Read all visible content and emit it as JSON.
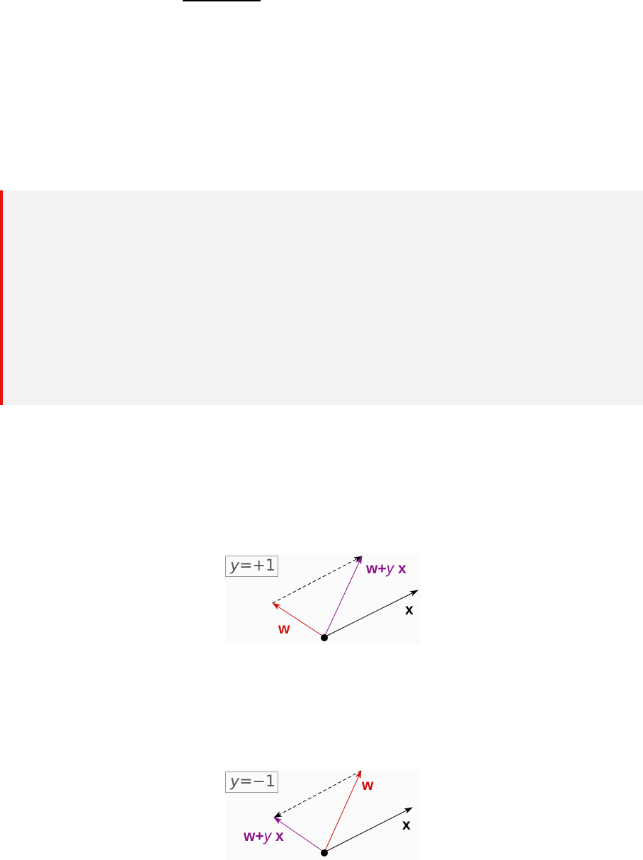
{
  "figures": [
    {
      "y_var": "y",
      "y_value": "=+1",
      "w_label": "w",
      "sum_label_a": "w+",
      "sum_label_var": "y",
      "sum_label_b": " x",
      "x_label": "x"
    },
    {
      "y_var": "y",
      "y_value": "=−1",
      "w_label": "w",
      "sum_label_a": "w+",
      "sum_label_var": "y",
      "sum_label_b": " x",
      "x_label": "x"
    }
  ],
  "colors": {
    "accent_bar": "#e8110f",
    "callout_bg": "#f2f2f2",
    "w_vector": "#d10f0f",
    "sum_vector": "#8b148b",
    "x_vector": "#000000"
  }
}
